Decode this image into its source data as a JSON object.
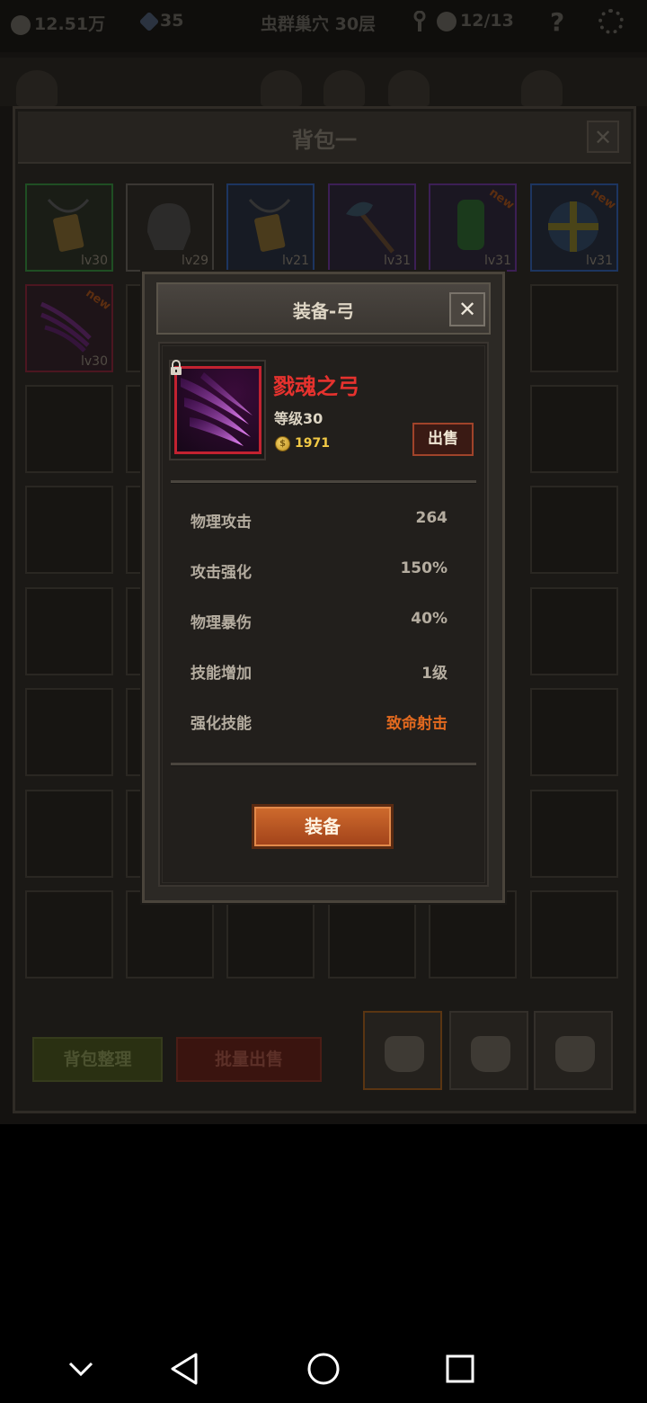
{
  "status": {
    "gold": "12.51万",
    "gems": "35",
    "location": "虫群巢穴 30层",
    "keys": "12/13",
    "help": "?"
  },
  "bag": {
    "title": "背包一",
    "close": "✕",
    "slots": [
      {
        "level": "lv30",
        "quality": "green",
        "icon": "gold-tablet-necklace-icon"
      },
      {
        "level": "lv29",
        "quality": "gray",
        "icon": "dark-helmet-icon"
      },
      {
        "level": "lv21",
        "quality": "blue",
        "icon": "gold-tablet-necklace-icon"
      },
      {
        "level": "lv31",
        "quality": "purple",
        "icon": "battle-axe-icon"
      },
      {
        "level": "lv31",
        "quality": "purple",
        "icon": "green-armor-icon",
        "new": "new"
      },
      {
        "level": "lv31",
        "quality": "blue",
        "icon": "round-shield-icon",
        "new": "new"
      },
      {
        "level": "lv30",
        "quality": "red",
        "icon": "purple-claw-bow-icon",
        "new": "new"
      }
    ],
    "sort_button": "背包整理",
    "bulk_sell_button": "批量出售"
  },
  "modal": {
    "title": "装备-弓",
    "close": "✕",
    "item": {
      "name": "戮魂之弓",
      "level": "等级30",
      "price": "1971",
      "coin_symbol": "$"
    },
    "sell_button": "出售",
    "stats": [
      {
        "label": "物理攻击",
        "value": "264"
      },
      {
        "label": "攻击强化",
        "value": "150%"
      },
      {
        "label": "物理暴伤",
        "value": "40%"
      },
      {
        "label": "技能增加",
        "value": "1级"
      },
      {
        "label": "强化技能",
        "value": "致命射击"
      }
    ],
    "equip_button": "装备"
  },
  "colors": {
    "item_name": "#e6322e",
    "skill_highlight": "#e46a1f",
    "equip_button": "#c0602a",
    "item_frame": "#c22230"
  },
  "nav": {
    "icons": [
      "chevron-down-icon",
      "back-icon",
      "home-icon",
      "recents-icon"
    ]
  }
}
